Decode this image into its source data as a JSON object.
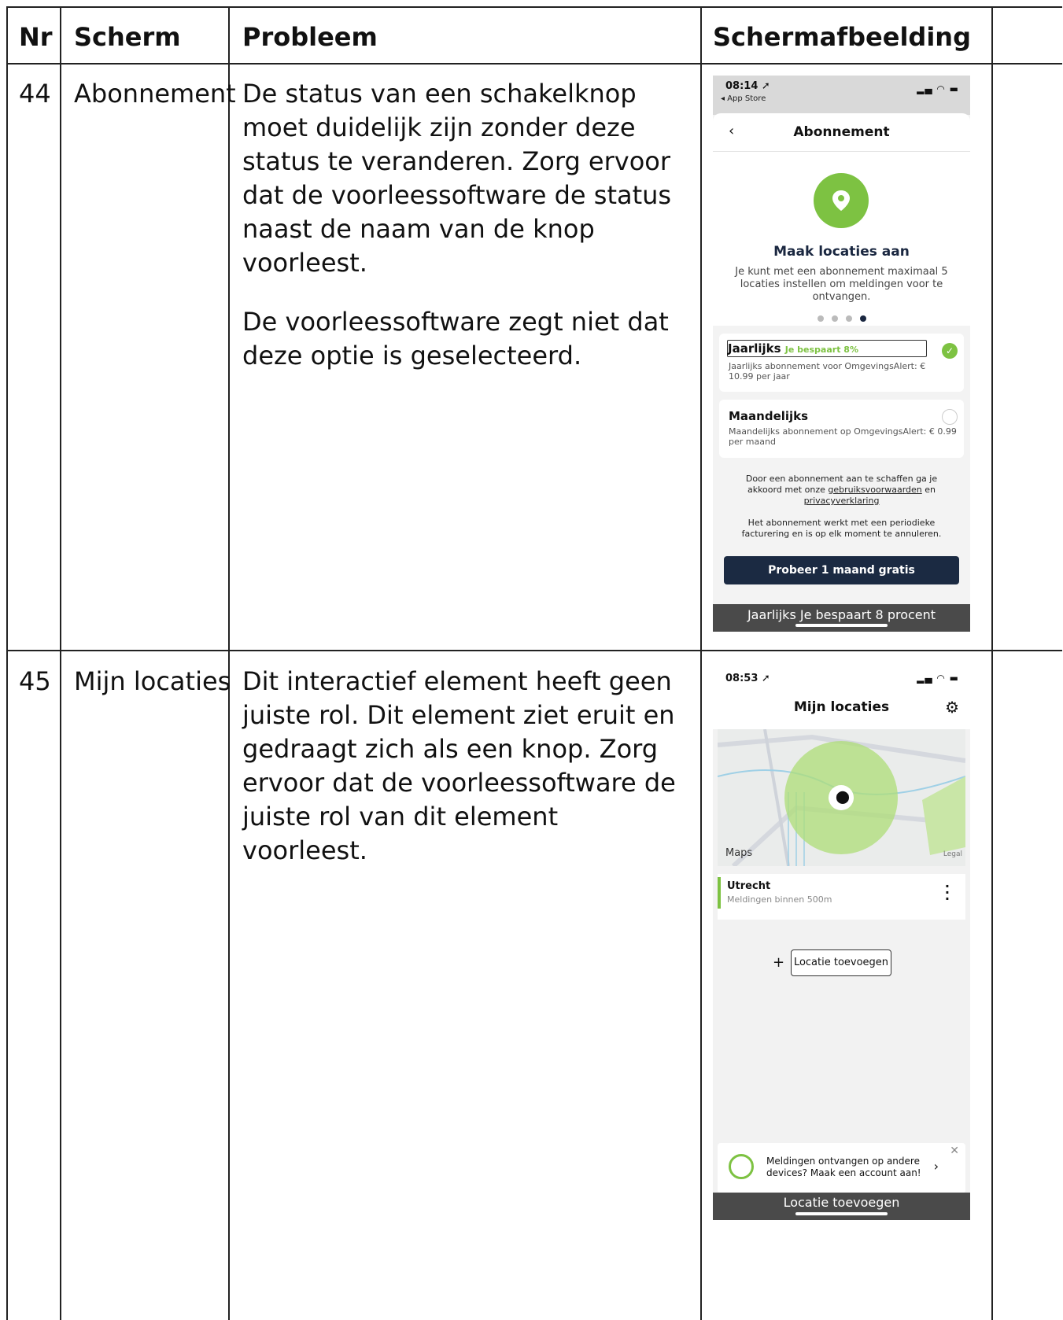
{
  "header": {
    "nr": "Nr",
    "scherm": "Scherm",
    "probleem": "Probleem",
    "schermafbeelding": "Schermafbeelding"
  },
  "rows": [
    {
      "nr": "44",
      "scherm": "Abonnement",
      "probleem": [
        "De status van een schakelknop moet duidelijk zijn zonder deze status te veranderen. Zorg ervoor dat de voorleessoftware de status naast de naam van de knop voorleest.",
        "De voorleessoftware zegt niet dat deze optie is geselecteerd."
      ],
      "screenshot": {
        "time": "08:14",
        "back_app": "◂ App Store",
        "title": "Abonnement",
        "heading": "Maak locaties aan",
        "subtext": "Je kunt met een abonnement maximaal 5 locaties instellen om meldingen voor te ontvangen.",
        "option1_label": "Jaarlijks",
        "option1_badge": "Je bespaart 8%",
        "option1_desc": "Jaarlijks abonnement voor OmgevingsAlert: € 10.99 per jaar",
        "option2_label": "Maandelijks",
        "option2_desc": "Maandelijks abonnement op OmgevingsAlert: € 0.99 per maand",
        "terms_pre": "Door een abonnement aan te schaffen ga je akkoord met onze",
        "terms_link1": "gebruiksvoorwaarden",
        "terms_and": "en",
        "terms_link2": "privacyverklaring",
        "billing": "Het abonnement werkt met een periodieke facturering en is op elk moment te annuleren.",
        "cta": "Probeer 1 maand gratis",
        "voiceover": "Jaarlijks Je bespaart 8 procent",
        "colors": {
          "accent": "#7dc242",
          "dark": "#1b2a42"
        }
      }
    },
    {
      "nr": "45",
      "scherm": "Mijn locaties",
      "probleem": [
        "Dit interactief element heeft geen juiste rol. Dit element ziet eruit en gedraagt zich als een knop. Zorg ervoor dat de voorleessoftware de juiste rol van dit element voorleest."
      ],
      "screenshot": {
        "time": "08:53",
        "title": "Mijn locaties",
        "maps_label": "Maps",
        "legal_label": "Legal",
        "location_name": "Utrecht",
        "location_desc": "Meldingen binnen 500m",
        "add_label": "Locatie toevoegen",
        "banner_text": "Meldingen ontvangen op andere devices? Maak een account aan!",
        "voiceover": "Locatie toevoegen"
      }
    }
  ]
}
